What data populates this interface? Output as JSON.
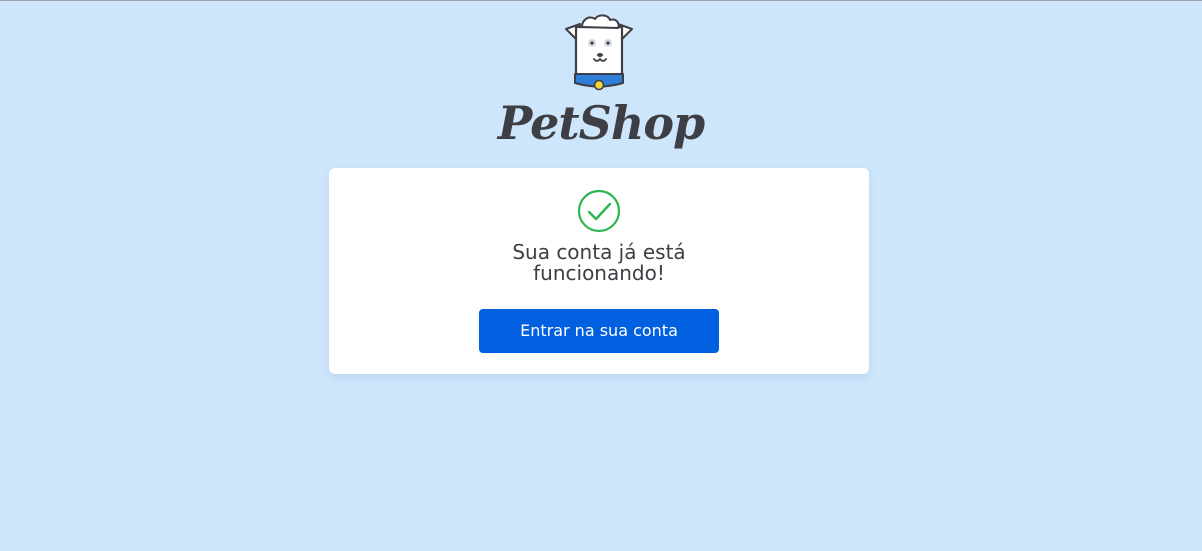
{
  "brand": {
    "name": "PetShop",
    "logo_icon": "dog-mascot-icon"
  },
  "confirmation": {
    "icon": "check-circle-icon",
    "message_line1": "Sua conta já está",
    "message_line2": "funcionando!",
    "button_label": "Entrar na sua conta"
  },
  "colors": {
    "background": "#cde6fc",
    "card": "#ffffff",
    "primary_button": "#0060e0",
    "success": "#2eb54f",
    "text": "#3d3f45",
    "collar": "#2f7fd9",
    "tag": "#f5d63d"
  }
}
